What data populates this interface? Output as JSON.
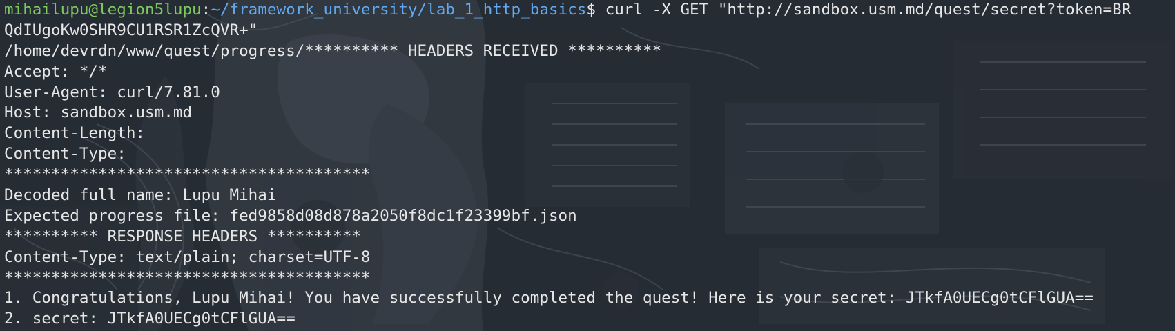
{
  "prompt": {
    "user_host": "mihailupu@legion5lupu",
    "separator": ":",
    "path": "~/framework_university/lab_1_http_basics",
    "symbol": "$ ",
    "command": "curl -X GET \"http://sandbox.usm.md/quest/secret?token=BR"
  },
  "output_lines": [
    "QdIUgoKw0SHR9CU1RSR1ZcQVR+\"",
    "/home/devrdn/www/quest/progress/********** HEADERS RECEIVED **********",
    "Accept: */*",
    "User-Agent: curl/7.81.0",
    "Host: sandbox.usm.md",
    "Content-Length:",
    "Content-Type:",
    "***************************************",
    "Decoded full name: Lupu Mihai",
    "Expected progress file: fed9858d08d878a2050f8dc1f23399bf.json",
    "********** RESPONSE HEADERS **********",
    "Content-Type: text/plain; charset=UTF-8",
    "***************************************",
    "1. Congratulations, Lupu Mihai! You have successfully completed the quest! Here is your secret: JTkfA0UECg0tCFlGUA==",
    "2. secret: JTkfA0UECg0tCFlGUA=="
  ],
  "colors": {
    "background": "#262c34",
    "text": "#e6e6e6",
    "user_host": "#7cc95c",
    "path": "#62a8ef"
  }
}
